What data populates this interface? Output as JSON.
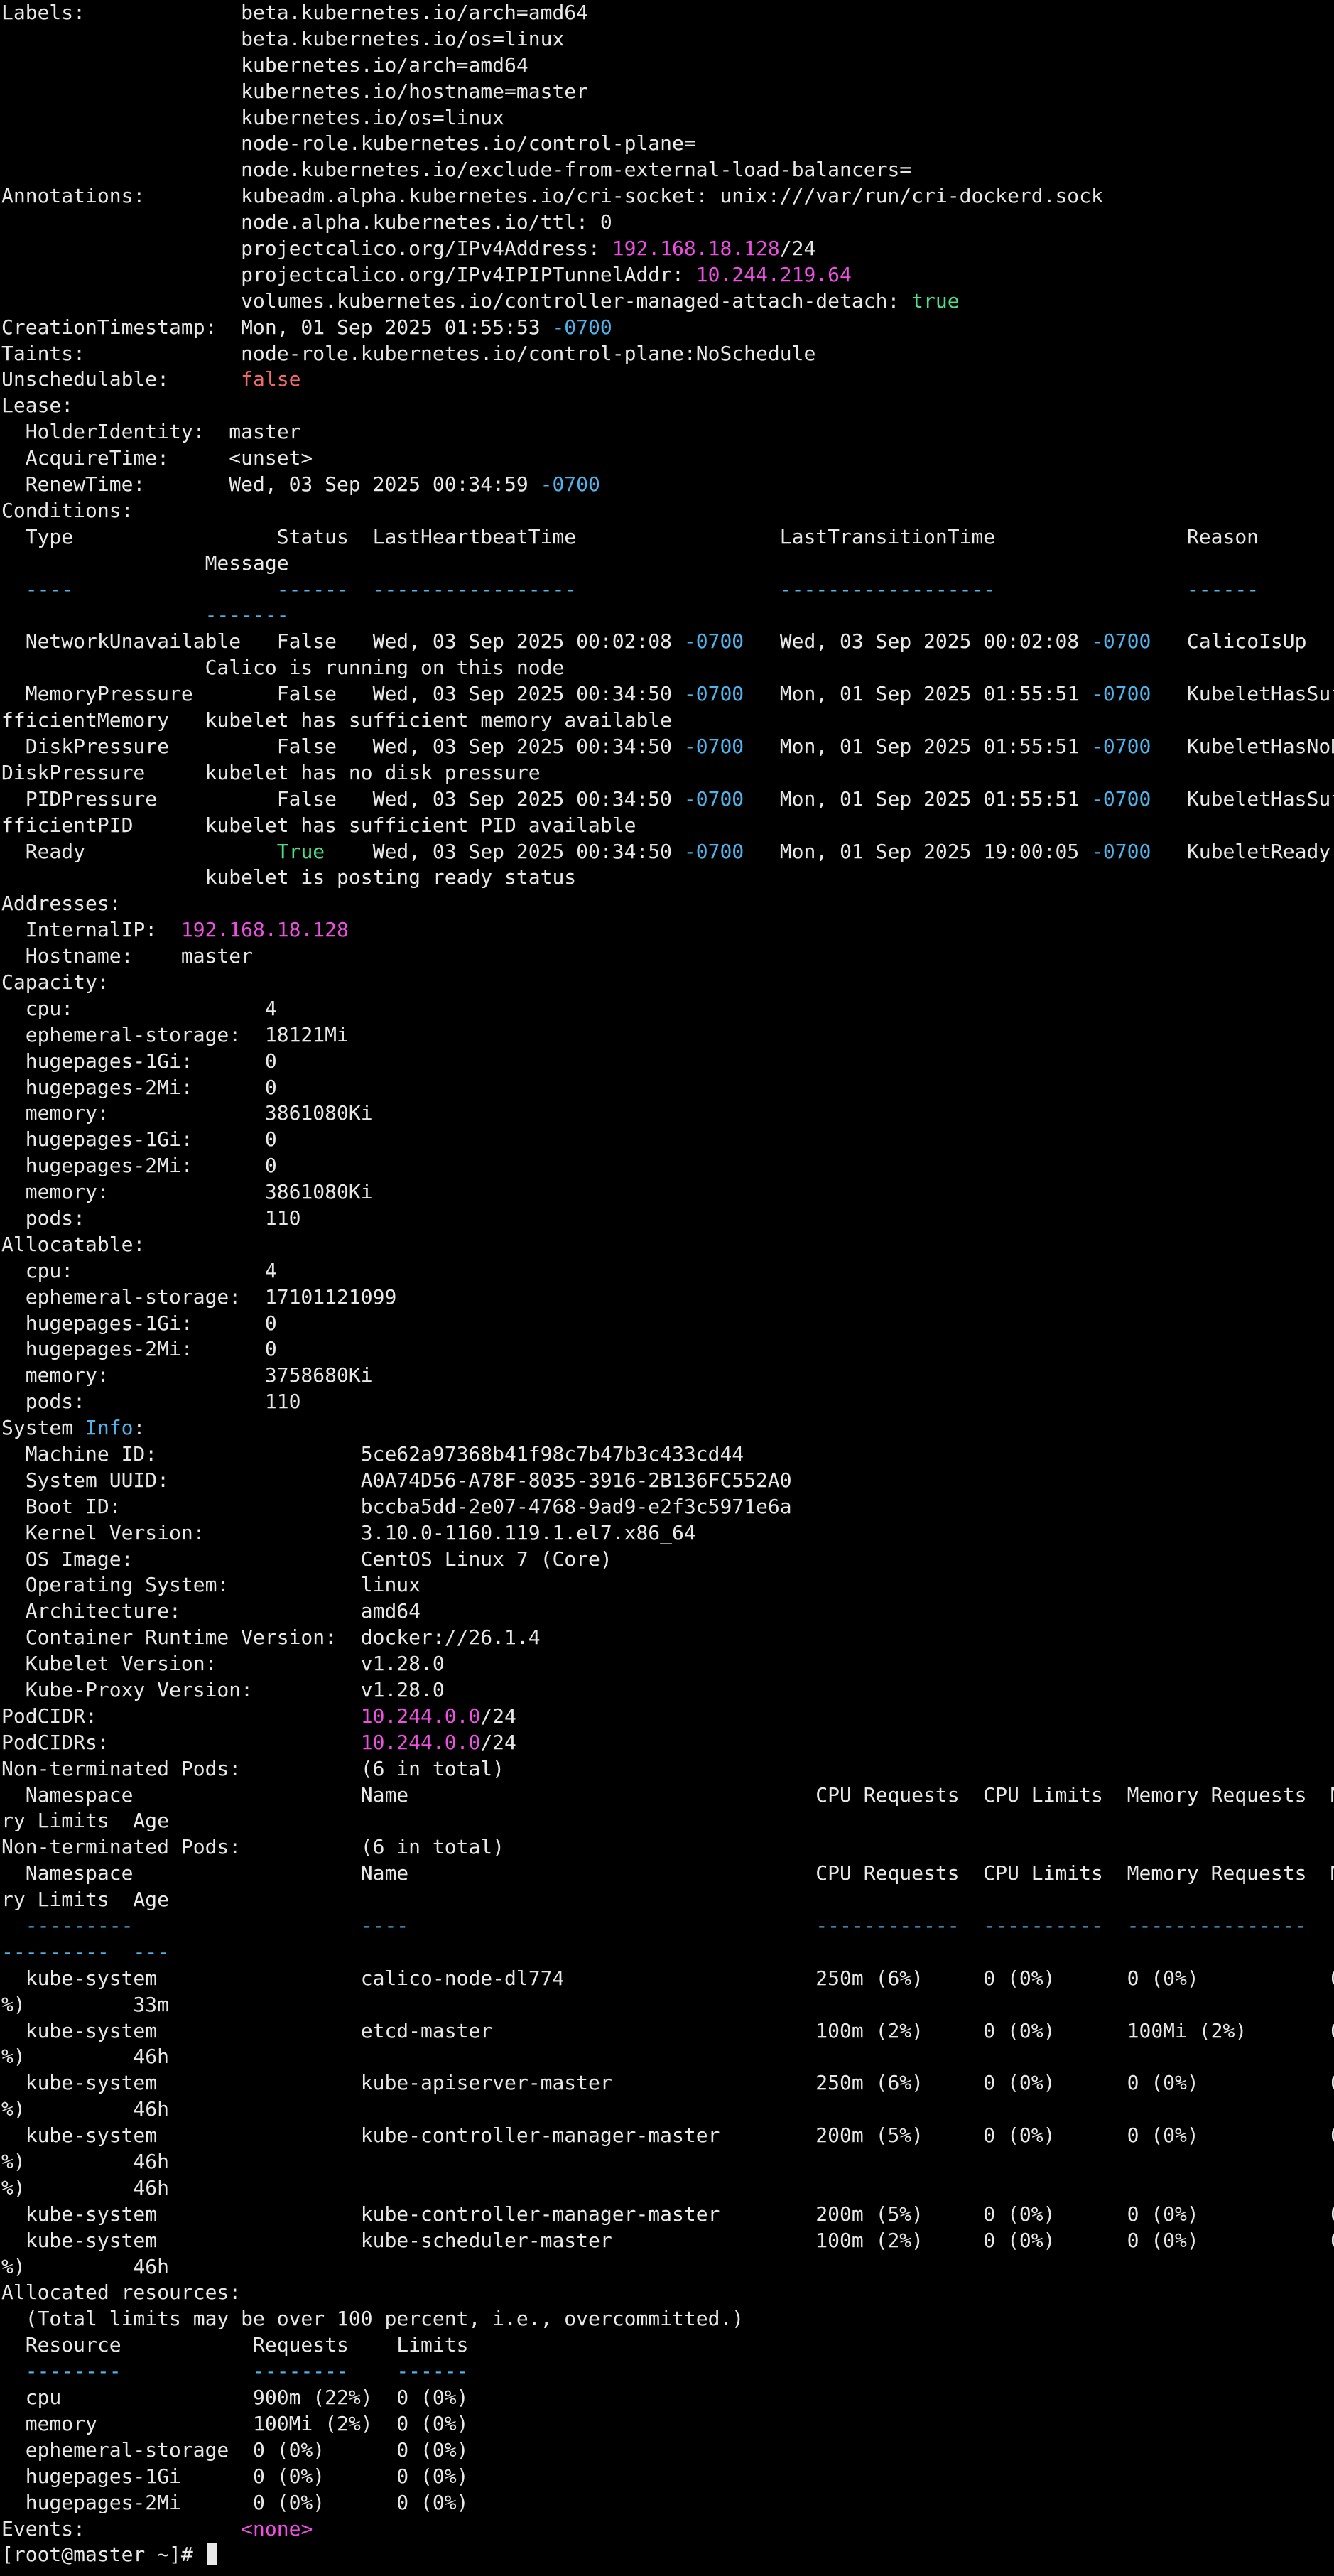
{
  "colors": {
    "background": "#000000",
    "default": "#e8e8e8",
    "cyan": "#4fb4ec",
    "magenta": "#ef4fe3",
    "green": "#4fdd86",
    "red": "#f06a6a"
  },
  "lines": [
    [
      {
        "t": "Labels:             beta.kubernetes.io/arch=amd64"
      }
    ],
    [
      {
        "t": "                    beta.kubernetes.io/os=linux"
      }
    ],
    [
      {
        "t": "                    kubernetes.io/arch=amd64"
      }
    ],
    [
      {
        "t": "                    kubernetes.io/hostname=master"
      }
    ],
    [
      {
        "t": "                    kubernetes.io/os=linux"
      }
    ],
    [
      {
        "t": "                    node-role.kubernetes.io/control-plane="
      }
    ],
    [
      {
        "t": "                    node.kubernetes.io/exclude-from-external-load-balancers="
      }
    ],
    [
      {
        "t": "Annotations:        kubeadm.alpha.kubernetes.io/cri-socket: unix:///var/run/cri-dockerd.sock"
      }
    ],
    [
      {
        "t": "                    node.alpha.kubernetes.io/ttl: 0"
      }
    ],
    [
      {
        "t": "                    projectcalico.org/IPv4Address: "
      },
      {
        "t": "192.168.18.128",
        "c": "magenta"
      },
      {
        "t": "/24"
      }
    ],
    [
      {
        "t": "                    projectcalico.org/IPv4IPIPTunnelAddr: "
      },
      {
        "t": "10.244.219.64",
        "c": "magenta"
      }
    ],
    [
      {
        "t": "                    volumes.kubernetes.io/controller-managed-attach-detach: "
      },
      {
        "t": "true",
        "c": "green"
      }
    ],
    [
      {
        "t": "CreationTimestamp:  Mon, 01 Sep 2025 01:55:53 "
      },
      {
        "t": "-0700",
        "c": "cyan"
      }
    ],
    [
      {
        "t": "Taints:             node-role.kubernetes.io/control-plane:NoSchedule"
      }
    ],
    [
      {
        "t": "Unschedulable:      "
      },
      {
        "t": "false",
        "c": "red"
      }
    ],
    [
      {
        "t": "Lease:"
      }
    ],
    [
      {
        "t": "  HolderIdentity:  master"
      }
    ],
    [
      {
        "t": "  AcquireTime:     <unset>"
      }
    ],
    [
      {
        "t": "  RenewTime:       Wed, 03 Sep 2025 00:34:59 "
      },
      {
        "t": "-0700",
        "c": "cyan"
      }
    ],
    [
      {
        "t": "Conditions:"
      }
    ],
    [
      {
        "t": "  Type                 Status  LastHeartbeatTime                 LastTransitionTime                Reason"
      }
    ],
    [
      {
        "t": "                 Message"
      }
    ],
    [
      {
        "t": "  ----",
        "c": "cyan"
      },
      {
        "t": "                 "
      },
      {
        "t": "------",
        "c": "cyan"
      },
      {
        "t": "  "
      },
      {
        "t": "-----------------",
        "c": "cyan"
      },
      {
        "t": "                 "
      },
      {
        "t": "------------------",
        "c": "cyan"
      },
      {
        "t": "                "
      },
      {
        "t": "------",
        "c": "cyan"
      }
    ],
    [
      {
        "t": "                 "
      },
      {
        "t": "-------",
        "c": "cyan"
      }
    ],
    [
      {
        "t": "  NetworkUnavailable   False   Wed, 03 Sep 2025 00:02:08 "
      },
      {
        "t": "-0700",
        "c": "cyan"
      },
      {
        "t": "   Wed, 03 Sep 2025 00:02:08 "
      },
      {
        "t": "-0700",
        "c": "cyan"
      },
      {
        "t": "   CalicoIsUp"
      }
    ],
    [
      {
        "t": "                 Calico is running on this node"
      }
    ],
    [
      {
        "t": "  MemoryPressure       False   Wed, 03 Sep 2025 00:34:50 "
      },
      {
        "t": "-0700",
        "c": "cyan"
      },
      {
        "t": "   Mon, 01 Sep 2025 01:55:51 "
      },
      {
        "t": "-0700",
        "c": "cyan"
      },
      {
        "t": "   KubeletHasSufficientMemory"
      }
    ],
    [
      {
        "t": "fficientMemory   kubelet has sufficient memory available"
      }
    ],
    [
      {
        "t": "  DiskPressure         False   Wed, 03 Sep 2025 00:34:50 "
      },
      {
        "t": "-0700",
        "c": "cyan"
      },
      {
        "t": "   Mon, 01 Sep 2025 01:55:51 "
      },
      {
        "t": "-0700",
        "c": "cyan"
      },
      {
        "t": "   KubeletHasNoDiskPressure"
      }
    ],
    [
      {
        "t": "DiskPressure     kubelet has no disk pressure"
      }
    ],
    [
      {
        "t": "  PIDPressure          False   Wed, 03 Sep 2025 00:34:50 "
      },
      {
        "t": "-0700",
        "c": "cyan"
      },
      {
        "t": "   Mon, 01 Sep 2025 01:55:51 "
      },
      {
        "t": "-0700",
        "c": "cyan"
      },
      {
        "t": "   KubeletHasSufficientPID"
      }
    ],
    [
      {
        "t": "fficientPID      kubelet has sufficient PID available"
      }
    ],
    [
      {
        "t": "  Ready                "
      },
      {
        "t": "True",
        "c": "green"
      },
      {
        "t": "    Wed, 03 Sep 2025 00:34:50 "
      },
      {
        "t": "-0700",
        "c": "cyan"
      },
      {
        "t": "   Mon, 01 Sep 2025 19:00:05 "
      },
      {
        "t": "-0700",
        "c": "cyan"
      },
      {
        "t": "   KubeletReady"
      }
    ],
    [
      {
        "t": "                 kubelet is posting ready status"
      }
    ],
    [
      {
        "t": "Addresses:"
      }
    ],
    [
      {
        "t": "  InternalIP:  "
      },
      {
        "t": "192.168.18.128",
        "c": "magenta"
      }
    ],
    [
      {
        "t": "  Hostname:    master"
      }
    ],
    [
      {
        "t": "Capacity:"
      }
    ],
    [
      {
        "t": "  cpu:                4"
      }
    ],
    [
      {
        "t": "  ephemeral-storage:  18121Mi"
      }
    ],
    [
      {
        "t": "  hugepages-1Gi:      0"
      }
    ],
    [
      {
        "t": "  hugepages-2Mi:      0"
      }
    ],
    [
      {
        "t": "  memory:             3861080Ki"
      }
    ],
    [
      {
        "t": "  hugepages-1Gi:      0"
      }
    ],
    [
      {
        "t": "  hugepages-2Mi:      0"
      }
    ],
    [
      {
        "t": "  memory:             3861080Ki"
      }
    ],
    [
      {
        "t": "  pods:               110"
      }
    ],
    [
      {
        "t": "Allocatable:"
      }
    ],
    [
      {
        "t": "  cpu:                4"
      }
    ],
    [
      {
        "t": "  ephemeral-storage:  17101121099"
      }
    ],
    [
      {
        "t": "  hugepages-1Gi:      0"
      }
    ],
    [
      {
        "t": "  hugepages-2Mi:      0"
      }
    ],
    [
      {
        "t": "  memory:             3758680Ki"
      }
    ],
    [
      {
        "t": "  pods:               110"
      }
    ],
    [
      {
        "t": "System "
      },
      {
        "t": "Info",
        "c": "cyan"
      },
      {
        "t": ":"
      }
    ],
    [
      {
        "t": "  Machine ID:                 5ce62a97368b41f98c7b47b3c433cd44"
      }
    ],
    [
      {
        "t": "  System UUID:                A0A74D56-A78F-8035-3916-2B136FC552A0"
      }
    ],
    [
      {
        "t": "  Boot ID:                    bccba5dd-2e07-4768-9ad9-e2f3c5971e6a"
      }
    ],
    [
      {
        "t": "  Kernel Version:             3.10.0-1160.119.1.el7.x86_64"
      }
    ],
    [
      {
        "t": "  OS Image:                   CentOS Linux 7 (Core)"
      }
    ],
    [
      {
        "t": "  Operating System:           linux"
      }
    ],
    [
      {
        "t": "  Architecture:               amd64"
      }
    ],
    [
      {
        "t": "  Container Runtime Version:  docker://26.1.4"
      }
    ],
    [
      {
        "t": "  Kubelet Version:            v1.28.0"
      }
    ],
    [
      {
        "t": "  Kube-Proxy Version:         v1.28.0"
      }
    ],
    [
      {
        "t": "PodCIDR:                      "
      },
      {
        "t": "10.244.0.0",
        "c": "magenta"
      },
      {
        "t": "/24"
      }
    ],
    [
      {
        "t": "PodCIDRs:                     "
      },
      {
        "t": "10.244.0.0",
        "c": "magenta"
      },
      {
        "t": "/24"
      }
    ],
    [
      {
        "t": "Non-terminated Pods:          (6 in total)"
      }
    ],
    [
      {
        "t": "  Namespace                   Name                                  CPU Requests  CPU Limits  Memory Requests  Memory Limits"
      }
    ],
    [
      {
        "t": "ry Limits  Age"
      }
    ],
    [
      {
        "t": "Non-terminated Pods:          (6 in total)"
      }
    ],
    [
      {
        "t": "  Namespace                   Name                                  CPU Requests  CPU Limits  Memory Requests  Memory Limits"
      }
    ],
    [
      {
        "t": "ry Limits  Age"
      }
    ],
    [
      {
        "t": "  ---------",
        "c": "cyan"
      },
      {
        "t": "                   "
      },
      {
        "t": "----",
        "c": "cyan"
      },
      {
        "t": "                                  "
      },
      {
        "t": "------------",
        "c": "cyan"
      },
      {
        "t": "  "
      },
      {
        "t": "----------",
        "c": "cyan"
      },
      {
        "t": "  "
      },
      {
        "t": "---------------",
        "c": "cyan"
      },
      {
        "t": "  "
      },
      {
        "t": "-------------",
        "c": "cyan"
      }
    ],
    [
      {
        "t": "---------",
        "c": "cyan"
      },
      {
        "t": "  "
      },
      {
        "t": "---",
        "c": "cyan"
      }
    ],
    [
      {
        "t": "  kube-system                 calico-node-dl774                     250m (6%)     0 (0%)      0 (0%)           0 (0%)"
      }
    ],
    [
      {
        "t": "%)         33m"
      }
    ],
    [
      {
        "t": "  kube-system                 etcd-master                           100m (2%)     0 (0%)      100Mi (2%)       0 (0%)"
      }
    ],
    [
      {
        "t": "%)         46h"
      }
    ],
    [
      {
        "t": "  kube-system                 kube-apiserver-master                 250m (6%)     0 (0%)      0 (0%)           0 (0%)"
      }
    ],
    [
      {
        "t": "%)         46h"
      }
    ],
    [
      {
        "t": "  kube-system                 kube-controller-manager-master        200m (5%)     0 (0%)      0 (0%)           0 (0%)"
      }
    ],
    [
      {
        "t": "%)         46h"
      }
    ],
    [
      {
        "t": "%)         46h"
      }
    ],
    [
      {
        "t": "  kube-system                 kube-controller-manager-master        200m (5%)     0 (0%)      0 (0%)           0 (0%)"
      }
    ],
    [
      {
        "t": "  kube-system                 kube-scheduler-master                 100m (2%)     0 (0%)      0 (0%)           0 (0%)"
      }
    ],
    [
      {
        "t": "%)         46h"
      }
    ],
    [
      {
        "t": "Allocated resources:"
      }
    ],
    [
      {
        "t": "  (Total limits may be over 100 percent, i.e., overcommitted.)"
      }
    ],
    [
      {
        "t": "  Resource           Requests    Limits"
      }
    ],
    [
      {
        "t": "  --------",
        "c": "cyan"
      },
      {
        "t": "           "
      },
      {
        "t": "--------",
        "c": "cyan"
      },
      {
        "t": "    "
      },
      {
        "t": "------",
        "c": "cyan"
      }
    ],
    [
      {
        "t": "  cpu                900m (22%)  0 (0%)"
      }
    ],
    [
      {
        "t": "  memory             100Mi (2%)  0 (0%)"
      }
    ],
    [
      {
        "t": "  ephemeral-storage  0 (0%)      0 (0%)"
      }
    ],
    [
      {
        "t": "  hugepages-1Gi      0 (0%)      0 (0%)"
      }
    ],
    [
      {
        "t": "  hugepages-2Mi      0 (0%)      0 (0%)"
      }
    ],
    [
      {
        "t": "Events:             "
      },
      {
        "t": "<none>",
        "c": "magenta"
      }
    ]
  ],
  "prompt": {
    "text": "[root@master ~]# "
  }
}
